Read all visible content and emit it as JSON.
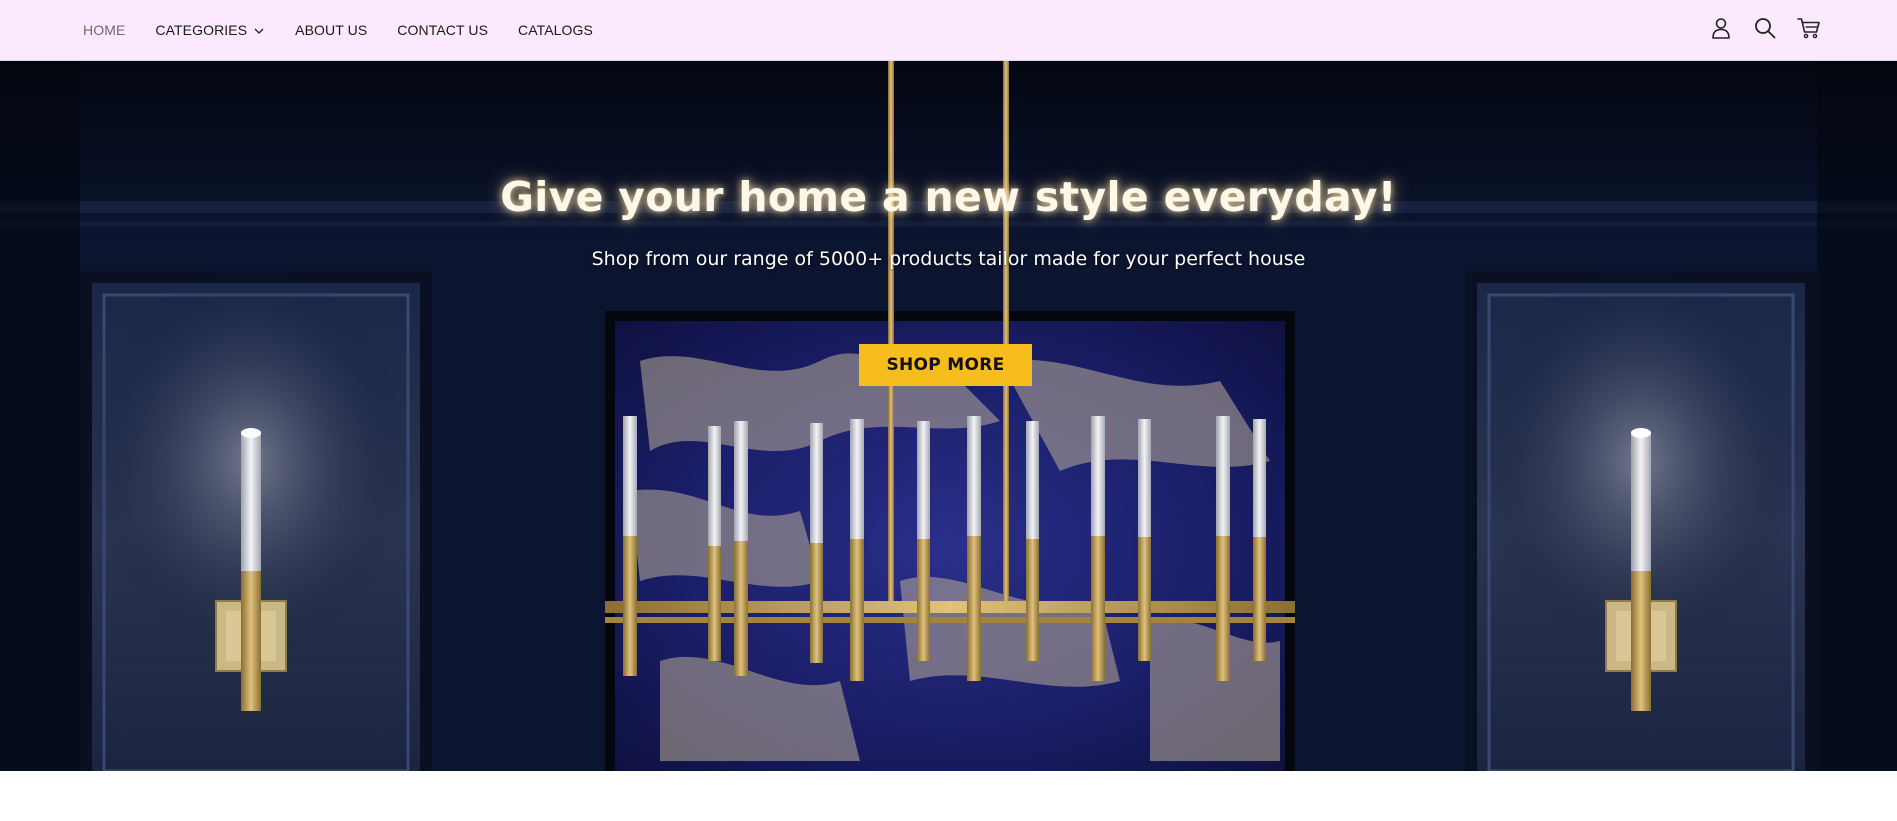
{
  "nav": {
    "items": [
      {
        "label": "HOME",
        "active": true
      },
      {
        "label": "CATEGORIES",
        "has_dropdown": true
      },
      {
        "label": "ABOUT US"
      },
      {
        "label": "CONTACT US"
      },
      {
        "label": "CATALOGS"
      }
    ]
  },
  "header_icons": [
    "user-icon",
    "search-icon",
    "cart-icon"
  ],
  "hero": {
    "title": "Give your home a new style everyday!",
    "subtitle": "Shop from our range of 5000+ products tailor made for your perfect house",
    "cta_label": "SHOP MORE"
  },
  "colors": {
    "header_bg": "#fbeafd",
    "cta_bg": "#f7bd1d",
    "hero_bg": "#0b1733",
    "gold": "#c9a655"
  }
}
